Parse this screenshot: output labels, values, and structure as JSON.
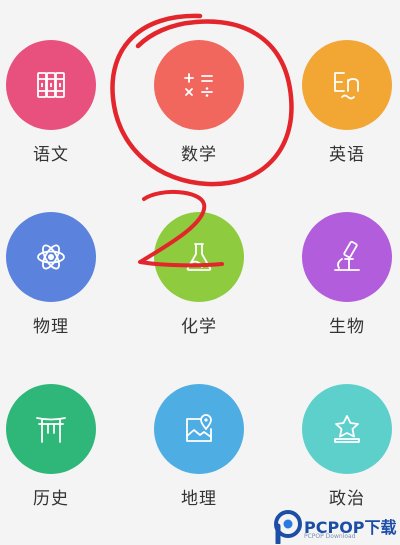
{
  "subjects": [
    {
      "label": "语文",
      "icon": "books-icon",
      "color": "#e8507e"
    },
    {
      "label": "数学",
      "icon": "math-operators-icon",
      "color": "#f1675d"
    },
    {
      "label": "英语",
      "icon": "english-en-icon",
      "color": "#f2a634"
    },
    {
      "label": "物理",
      "icon": "atom-icon",
      "color": "#5b82dc"
    },
    {
      "label": "化学",
      "icon": "flask-icon",
      "color": "#8fcb3e"
    },
    {
      "label": "生物",
      "icon": "microscope-icon",
      "color": "#b15ddc"
    },
    {
      "label": "历史",
      "icon": "archway-icon",
      "color": "#2fb679"
    },
    {
      "label": "地理",
      "icon": "map-pin-icon",
      "color": "#4eaee3"
    },
    {
      "label": "政治",
      "icon": "star-badge-icon",
      "color": "#5ed0cc"
    }
  ],
  "annotations": {
    "stroke_color": "#e2262b",
    "handwritten_number": "2"
  },
  "watermark": {
    "text": "PCPOP下载",
    "subtext": "PCPOP Download"
  }
}
